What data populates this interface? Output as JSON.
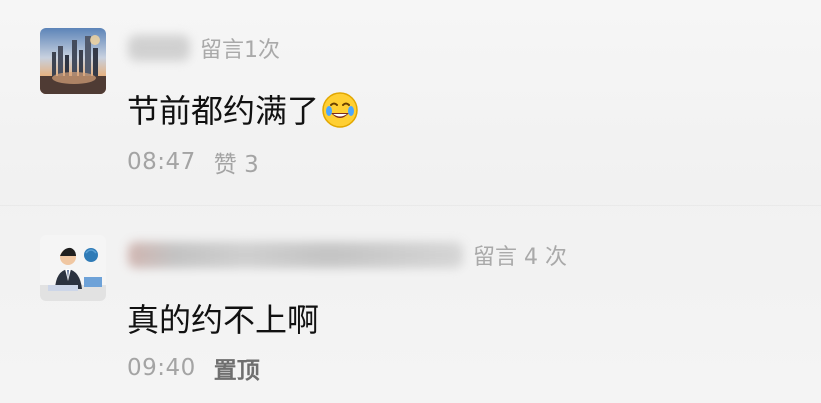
{
  "comments": [
    {
      "message_count": "留言1次",
      "text": "节前都约满了",
      "emoji_icon": "crying-laughing-face-icon",
      "time": "08:47",
      "action": "赞 3"
    },
    {
      "message_count": "留言 4 次",
      "text": "真的约不上啊",
      "time": "09:40",
      "action": "置顶"
    }
  ],
  "colors": {
    "background": "#f3f3f3",
    "meta_text": "#a9a9a9",
    "message_text": "#111111",
    "pin_text": "#6f6f6f"
  }
}
